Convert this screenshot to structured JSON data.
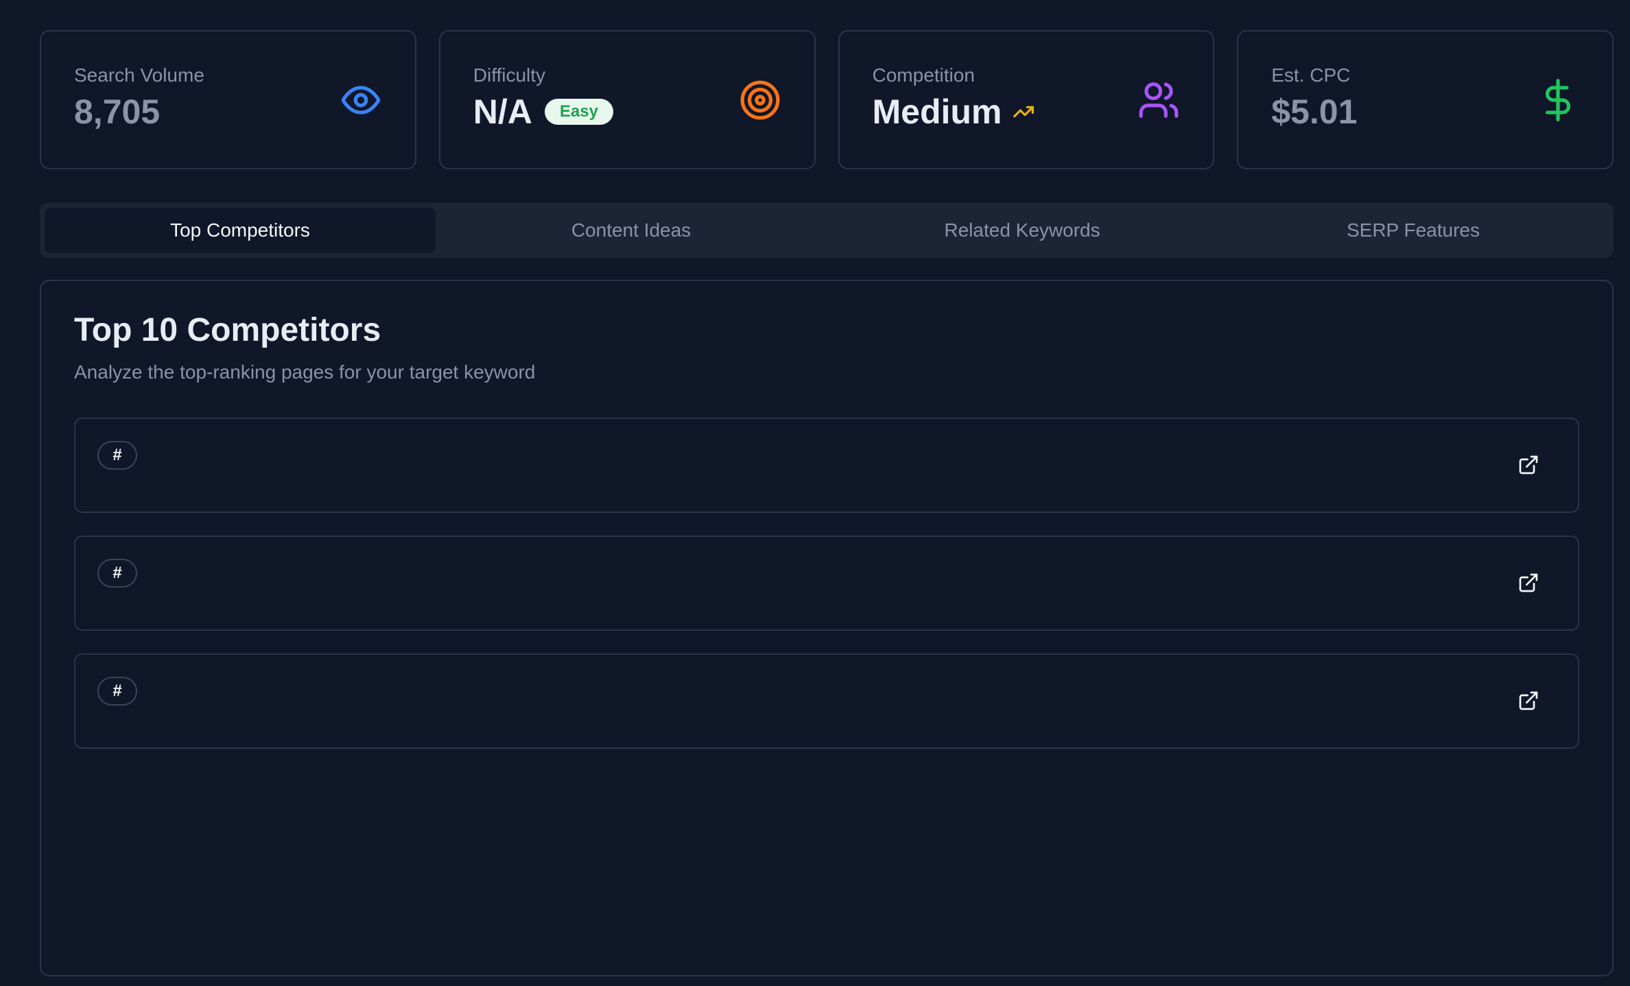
{
  "stats": [
    {
      "label": "Search Volume",
      "value": "8,705",
      "icon": "eye-icon",
      "color": "#3b82f6"
    },
    {
      "label": "Difficulty",
      "value": "N/A",
      "badge": "Easy",
      "icon": "target-icon",
      "color": "#f97316"
    },
    {
      "label": "Competition",
      "value": "Medium",
      "trend_icon": "trending-up-icon",
      "icon": "users-icon",
      "color": "#a855f7"
    },
    {
      "label": "Est. CPC",
      "value": "$5.01",
      "icon": "dollar-icon",
      "color": "#22c55e"
    }
  ],
  "tabs": [
    {
      "label": "Top Competitors",
      "active": true
    },
    {
      "label": "Content Ideas",
      "active": false
    },
    {
      "label": "Related Keywords",
      "active": false
    },
    {
      "label": "SERP Features",
      "active": false
    }
  ],
  "panel": {
    "title": "Top 10 Competitors",
    "subtitle": "Analyze the top-ranking pages for your target keyword"
  },
  "competitors": [
    {
      "rank": "#",
      "link_icon": "external-link-icon"
    },
    {
      "rank": "#",
      "link_icon": "external-link-icon"
    },
    {
      "rank": "#",
      "link_icon": "external-link-icon"
    }
  ],
  "colors": {
    "background": "#0f1729",
    "trend": "#eab308",
    "badge_easy_bg": "#e8f7ec",
    "badge_easy_text": "#22a052"
  }
}
